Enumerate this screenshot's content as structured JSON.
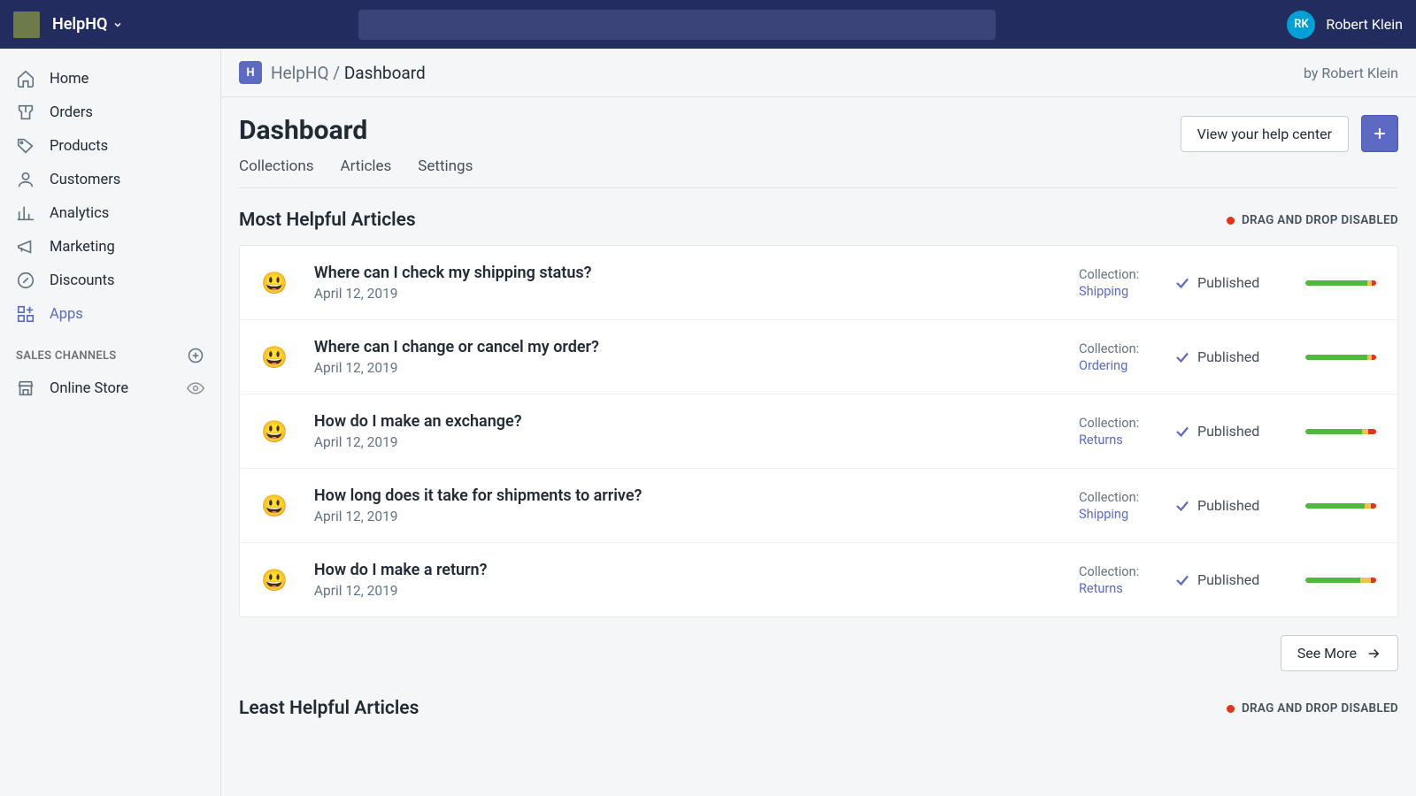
{
  "topbar": {
    "app_name": "HelpHQ",
    "avatar_initials": "RK",
    "user_name": "Robert Klein"
  },
  "sidebar": {
    "items": [
      {
        "label": "Home"
      },
      {
        "label": "Orders"
      },
      {
        "label": "Products"
      },
      {
        "label": "Customers"
      },
      {
        "label": "Analytics"
      },
      {
        "label": "Marketing"
      },
      {
        "label": "Discounts"
      },
      {
        "label": "Apps"
      }
    ],
    "section_label": "SALES CHANNELS",
    "channels": [
      {
        "label": "Online Store"
      }
    ]
  },
  "header": {
    "app_badge": "H",
    "breadcrumb_app": "HelpHQ",
    "breadcrumb_sep": "/",
    "breadcrumb_current": "Dashboard",
    "byline_prefix": "by ",
    "byline_name": "Robert Klein"
  },
  "page": {
    "title": "Dashboard",
    "view_help_center": "View your help center",
    "tabs": [
      "Collections",
      "Articles",
      "Settings"
    ]
  },
  "most_helpful": {
    "title": "Most Helpful Articles",
    "drag_badge": "DRAG AND DROP DISABLED",
    "collection_label": "Collection:",
    "published_label": "Published",
    "see_more": "See More",
    "articles": [
      {
        "title": "Where can I check my shipping status?",
        "date": "April 12, 2019",
        "collection": "Shipping",
        "bar": [
          88,
          6,
          6
        ]
      },
      {
        "title": "Where can I change or cancel my order?",
        "date": "April 12, 2019",
        "collection": "Ordering",
        "bar": [
          88,
          6,
          6
        ]
      },
      {
        "title": "How do I make an exchange?",
        "date": "April 12, 2019",
        "collection": "Returns",
        "bar": [
          80,
          9,
          11
        ]
      },
      {
        "title": "How long does it take for shipments to arrive?",
        "date": "April 12, 2019",
        "collection": "Shipping",
        "bar": [
          84,
          8,
          8
        ]
      },
      {
        "title": "How do I make a return?",
        "date": "April 12, 2019",
        "collection": "Returns",
        "bar": [
          78,
          14,
          8
        ]
      }
    ]
  },
  "least_helpful": {
    "title": "Least Helpful Articles",
    "drag_badge": "DRAG AND DROP DISABLED"
  }
}
